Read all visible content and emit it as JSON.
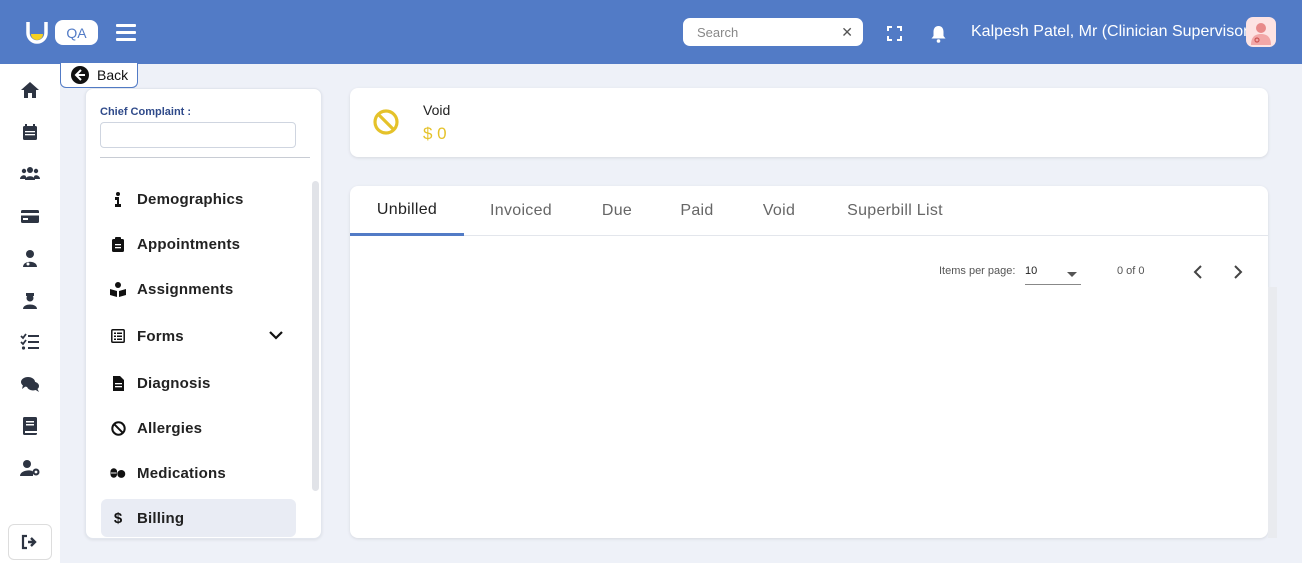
{
  "app": {
    "badge": "QA"
  },
  "header": {
    "search_placeholder": "Search",
    "user_name": "Kalpesh Patel, Mr (Clinician Supervisor)"
  },
  "rail": {
    "items": [
      "home-icon",
      "calendar-icon",
      "users-icon",
      "credit-card-icon",
      "user-md-icon",
      "user-nurse-icon",
      "task-list-icon",
      "comments-icon",
      "book-icon",
      "user-cog-icon"
    ],
    "logout": "logout-icon"
  },
  "back": {
    "label": "Back"
  },
  "chief_complaint": {
    "label": "Chief Complaint :",
    "value": ""
  },
  "menu": {
    "items": [
      {
        "label": "Demographics",
        "icon": "info-icon"
      },
      {
        "label": "Appointments",
        "icon": "clipboard-icon"
      },
      {
        "label": "Assignments",
        "icon": "book-reader-icon"
      },
      {
        "label": "Forms",
        "icon": "form-icon"
      },
      {
        "label": "Diagnosis",
        "icon": "file-icon"
      },
      {
        "label": "Allergies",
        "icon": "ban-icon"
      },
      {
        "label": "Medications",
        "icon": "pills-icon"
      },
      {
        "label": "Billing",
        "icon": "dollar-icon"
      }
    ],
    "active": "Billing"
  },
  "void_card": {
    "title": "Void",
    "amount": "$ 0"
  },
  "tabs": {
    "items": [
      "Unbilled",
      "Invoiced",
      "Due",
      "Paid",
      "Void",
      "Superbill List"
    ],
    "active": "Unbilled"
  },
  "pager": {
    "items_per_page_label": "Items per page:",
    "items_per_page_value": "10",
    "range": "0 of 0"
  },
  "colors": {
    "primary": "#527bc6",
    "void_yellow": "#e5c22a",
    "background": "#eef1f8"
  }
}
